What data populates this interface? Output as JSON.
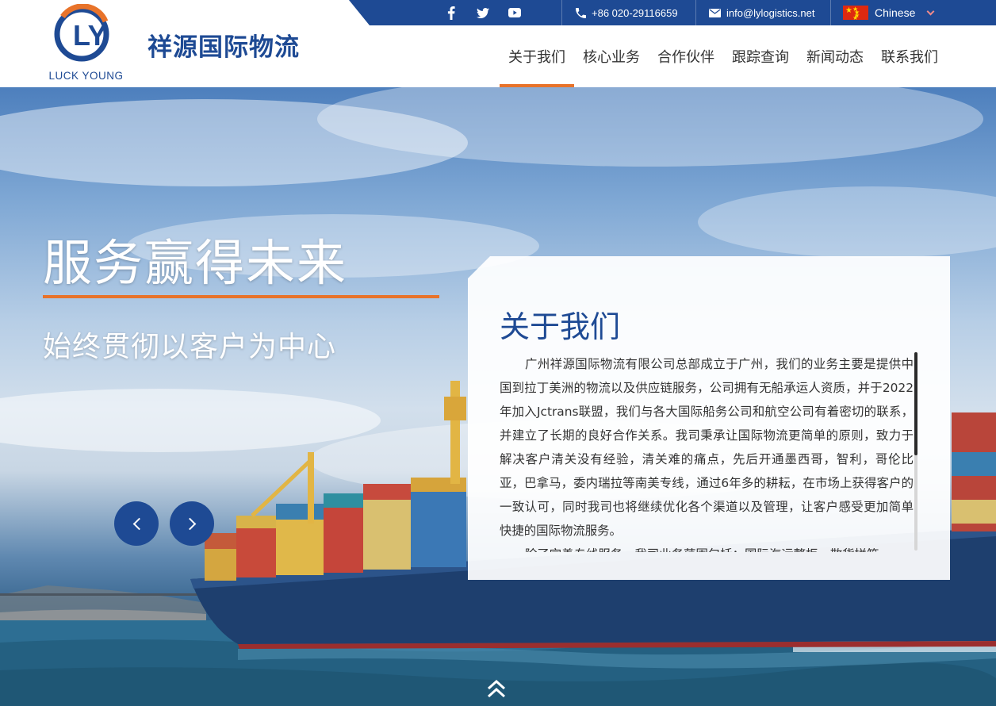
{
  "brand": {
    "logo_mark": "LY",
    "logo_text": "LUCK YOUNG",
    "name": "祥源国际物流"
  },
  "topbar": {
    "social": [
      {
        "icon": "facebook-icon",
        "glyph": "f"
      },
      {
        "icon": "twitter-icon",
        "glyph": "t"
      },
      {
        "icon": "youtube-icon",
        "glyph": "▶"
      }
    ],
    "phone": "+86 020-29116659",
    "email": "info@lylogistics.net",
    "language": "Chinese"
  },
  "nav": {
    "items": [
      "关于我们",
      "核心业务",
      "合作伙伴",
      "跟踪查询",
      "新闻动态",
      "联系我们"
    ],
    "active_index": 0
  },
  "hero": {
    "headline": "服务赢得未来",
    "subline": "始终贯彻以客户为中心",
    "prev_arrow": "previous-slide",
    "next_arrow": "next-slide"
  },
  "about": {
    "title": "关于我们",
    "paragraphs": [
      "广州祥源国际物流有限公司总部成立于广州，我们的业务主要是提供中国到拉丁美洲的物流以及供应链服务，公司拥有无船承运人资质，并于2022年加入Jctrans联盟，我们与各大国际船务公司和航空公司有着密切的联系，并建立了长期的良好合作关系。我司秉承让国际物流更简单的原则，致力于解决客户清关没有经验，清关难的痛点，先后开通墨西哥，智利，哥伦比亚，巴拿马，委内瑞拉等南美专线，通过6年多的耕耘，在市场上获得客户的一致认可，同时我司也将继续优化各个渠道以及管理，让客户感受更加简单快捷的国际物流服务。",
      "除了完善专线服务，我司业务范围包括：国际海运整柜、散货拼箱"
    ]
  },
  "colors": {
    "brand_blue": "#1e4a94",
    "accent_orange": "#e8732a"
  }
}
